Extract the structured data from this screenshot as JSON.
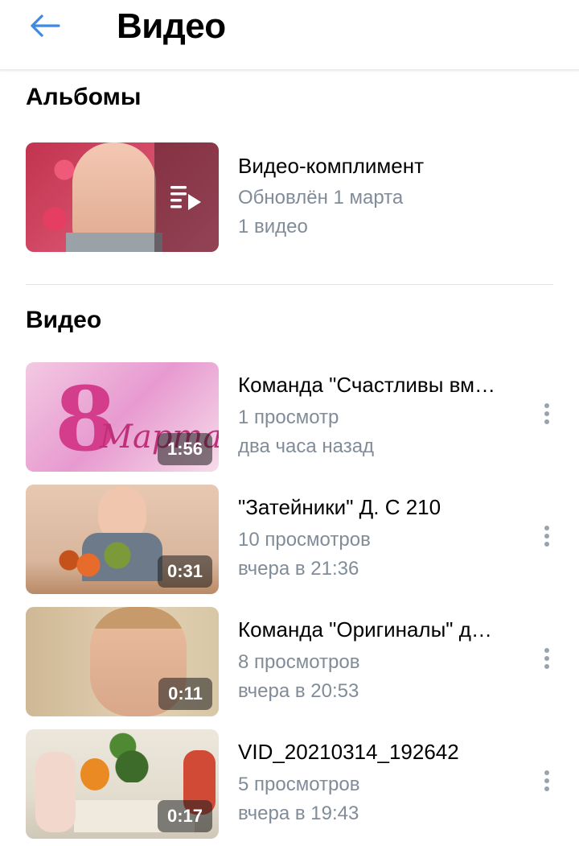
{
  "header": {
    "title": "Видео",
    "back_icon": "arrow-left-icon",
    "accent": "#3f8ae0"
  },
  "albums": {
    "section_title": "Альбомы",
    "items": [
      {
        "title": "Видео-комплимент",
        "updated": "Обновлён 1 марта",
        "count": "1 видео",
        "overlay_icon": "playlist-play-icon"
      }
    ]
  },
  "videos": {
    "section_title": "Видео",
    "items": [
      {
        "title": "Команда \"Счастливы вм…",
        "views": "1 просмотр",
        "date": "два часа назад",
        "duration": "1:56"
      },
      {
        "title": "\"Затейники\" Д. С 210",
        "views": "10 просмотров",
        "date": "вчера в 21:36",
        "duration": "0:31"
      },
      {
        "title": "Команда \"Оригиналы\" д…",
        "views": "8 просмотров",
        "date": "вчера в 20:53",
        "duration": "0:11"
      },
      {
        "title": "VID_20210314_192642",
        "views": "5 просмотров",
        "date": "вчера в 19:43",
        "duration": "0:17"
      }
    ]
  },
  "colors": {
    "secondary_text": "#818c99",
    "divider": "#e3e4e8"
  }
}
